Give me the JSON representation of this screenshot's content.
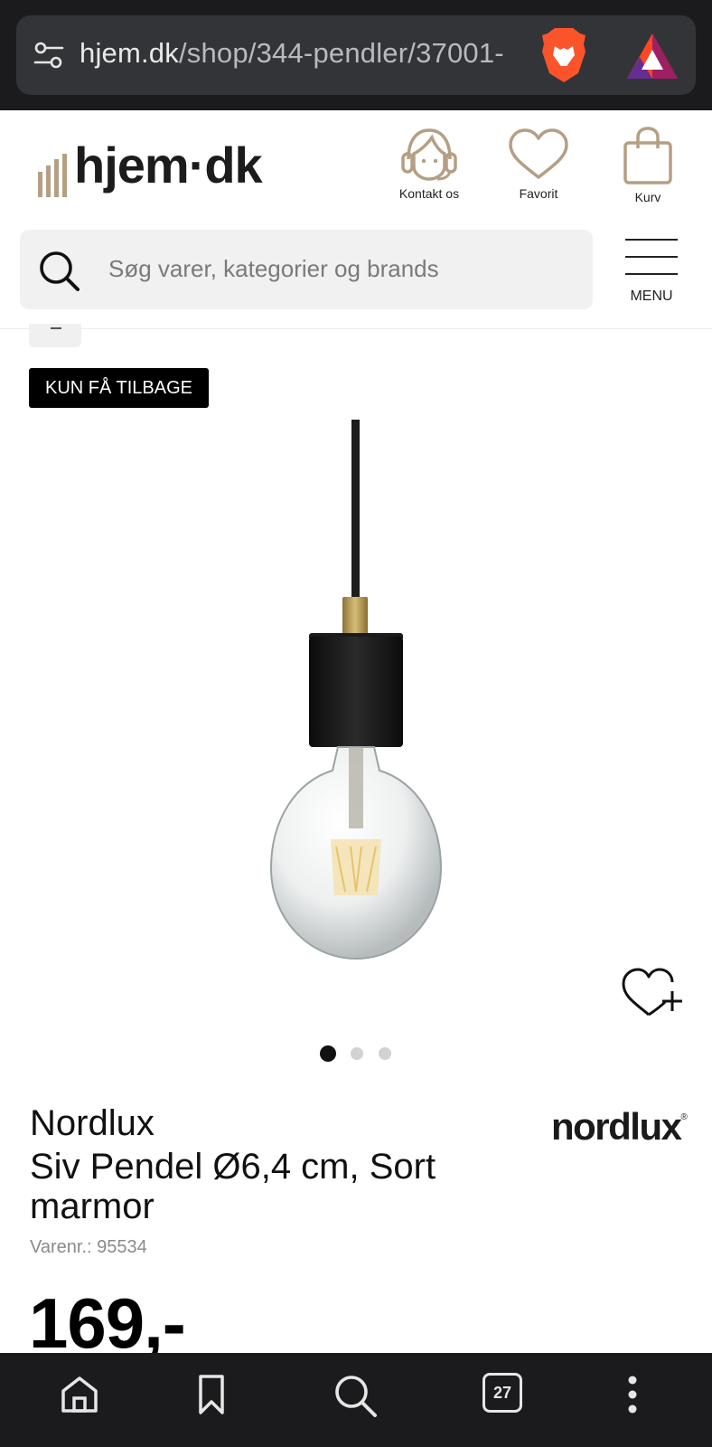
{
  "browser": {
    "url_host": "hjem.dk",
    "url_path": "/shop/344-pendler/37001-",
    "icons": [
      "tune-icon",
      "brave-lion-icon",
      "bat-rewards-icon"
    ]
  },
  "header": {
    "logo_text": "hjem·dk",
    "contact_label": "Kontakt os",
    "favorite_label": "Favorit",
    "cart_label": "Kurv",
    "search_placeholder": "Søg varer, kategorier og brands",
    "menu_label": "MENU"
  },
  "product": {
    "badge": "KUN FÅ TILBAGE",
    "brand": "Nordlux",
    "title": "Siv Pendel Ø6,4 cm, Sort marmor",
    "sku": "Varenr.: 95534",
    "brand_logo": "nordlux",
    "brand_logo_mark": "®",
    "price": "169,-",
    "carousel": {
      "count": 3,
      "active": 1
    }
  },
  "bottom_nav": {
    "tab_count": "27",
    "icons": [
      "home-icon",
      "bookmark-icon",
      "search-icon",
      "tabs-icon",
      "more-icon"
    ]
  },
  "colors": {
    "browser_bg": "#1b1b1d",
    "urlbar_bg": "#333438",
    "logo_accent": "#b59f84",
    "badge_bg": "#000000"
  }
}
